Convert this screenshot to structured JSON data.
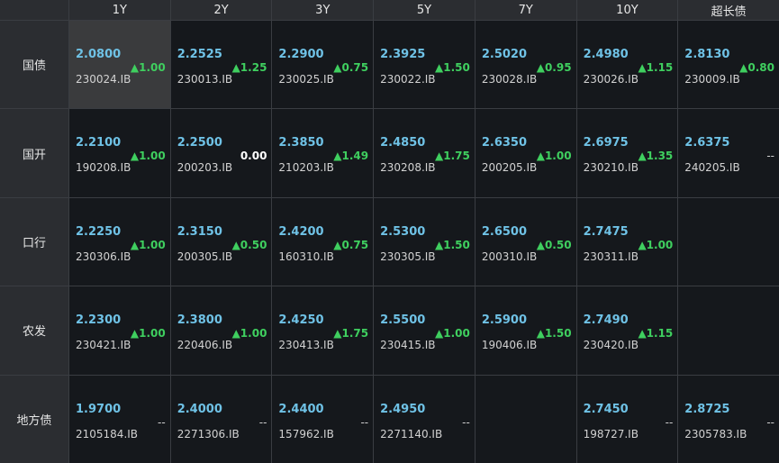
{
  "columns": [
    "1Y",
    "2Y",
    "3Y",
    "5Y",
    "7Y",
    "10Y",
    "超长债"
  ],
  "rows": [
    {
      "label": "国债",
      "cells": [
        {
          "yield": "2.0800",
          "code": "230024.IB",
          "change": "▲1.00",
          "dir": "up",
          "selected": true
        },
        {
          "yield": "2.2525",
          "code": "230013.IB",
          "change": "▲1.25",
          "dir": "up"
        },
        {
          "yield": "2.2900",
          "code": "230025.IB",
          "change": "▲0.75",
          "dir": "up"
        },
        {
          "yield": "2.3925",
          "code": "230022.IB",
          "change": "▲1.50",
          "dir": "up"
        },
        {
          "yield": "2.5020",
          "code": "230028.IB",
          "change": "▲0.95",
          "dir": "up"
        },
        {
          "yield": "2.4980",
          "code": "230026.IB",
          "change": "▲1.15",
          "dir": "up"
        },
        {
          "yield": "2.8130",
          "code": "230009.IB",
          "change": "▲0.80",
          "dir": "up"
        }
      ]
    },
    {
      "label": "国开",
      "cells": [
        {
          "yield": "2.2100",
          "code": "190208.IB",
          "change": "▲1.00",
          "dir": "up"
        },
        {
          "yield": "2.2500",
          "code": "200203.IB",
          "change": "0.00",
          "dir": "flat"
        },
        {
          "yield": "2.3850",
          "code": "210203.IB",
          "change": "▲1.49",
          "dir": "up"
        },
        {
          "yield": "2.4850",
          "code": "230208.IB",
          "change": "▲1.75",
          "dir": "up"
        },
        {
          "yield": "2.6350",
          "code": "200205.IB",
          "change": "▲1.00",
          "dir": "up"
        },
        {
          "yield": "2.6975",
          "code": "230210.IB",
          "change": "▲1.35",
          "dir": "up"
        },
        {
          "yield": "2.6375",
          "code": "240205.IB",
          "change": "--",
          "dir": "nil"
        }
      ]
    },
    {
      "label": "口行",
      "cells": [
        {
          "yield": "2.2250",
          "code": "230306.IB",
          "change": "▲1.00",
          "dir": "up"
        },
        {
          "yield": "2.3150",
          "code": "200305.IB",
          "change": "▲0.50",
          "dir": "up"
        },
        {
          "yield": "2.4200",
          "code": "160310.IB",
          "change": "▲0.75",
          "dir": "up"
        },
        {
          "yield": "2.5300",
          "code": "230305.IB",
          "change": "▲1.50",
          "dir": "up"
        },
        {
          "yield": "2.6500",
          "code": "200310.IB",
          "change": "▲0.50",
          "dir": "up"
        },
        {
          "yield": "2.7475",
          "code": "230311.IB",
          "change": "▲1.00",
          "dir": "up"
        },
        null
      ]
    },
    {
      "label": "农发",
      "cells": [
        {
          "yield": "2.2300",
          "code": "230421.IB",
          "change": "▲1.00",
          "dir": "up"
        },
        {
          "yield": "2.3800",
          "code": "220406.IB",
          "change": "▲1.00",
          "dir": "up"
        },
        {
          "yield": "2.4250",
          "code": "230413.IB",
          "change": "▲1.75",
          "dir": "up"
        },
        {
          "yield": "2.5500",
          "code": "230415.IB",
          "change": "▲1.00",
          "dir": "up"
        },
        {
          "yield": "2.5900",
          "code": "190406.IB",
          "change": "▲1.50",
          "dir": "up"
        },
        {
          "yield": "2.7490",
          "code": "230420.IB",
          "change": "▲1.15",
          "dir": "up"
        },
        null
      ]
    },
    {
      "label": "地方债",
      "cells": [
        {
          "yield": "1.9700",
          "code": "2105184.IB",
          "change": "--",
          "dir": "nil"
        },
        {
          "yield": "2.4000",
          "code": "2271306.IB",
          "change": "--",
          "dir": "nil"
        },
        {
          "yield": "2.4400",
          "code": "157962.IB",
          "change": "--",
          "dir": "nil"
        },
        {
          "yield": "2.4950",
          "code": "2271140.IB",
          "change": "--",
          "dir": "nil"
        },
        null,
        {
          "yield": "2.7450",
          "code": "198727.IB",
          "change": "--",
          "dir": "nil"
        },
        {
          "yield": "2.8725",
          "code": "2305783.IB",
          "change": "--",
          "dir": "nil"
        }
      ]
    }
  ],
  "colors": {
    "yield": "#6fc2e6",
    "up": "#3fcf5f",
    "flat": "#ffffff",
    "cell_bg": "#15181c",
    "selected_bg": "#3a3b3d"
  }
}
